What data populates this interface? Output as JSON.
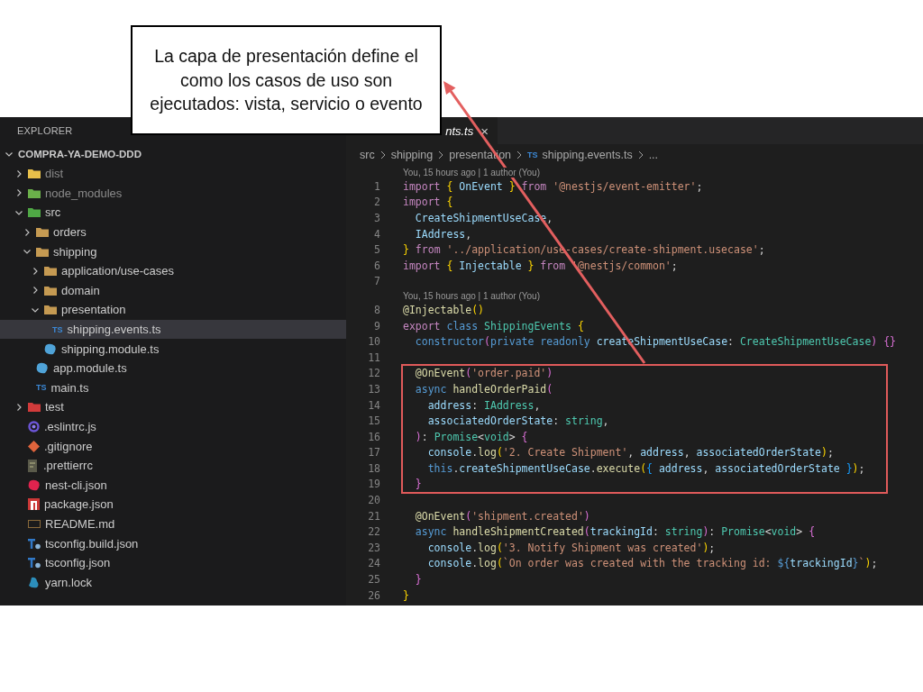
{
  "callout": {
    "text": "La capa de presentación define el como los casos de uso son ejecutados: vista, servicio o evento"
  },
  "explorer": {
    "title": "EXPLORER",
    "project": {
      "label": "COMPRA-YA-DEMO-DDD",
      "expanded": true
    },
    "tree": [
      {
        "label": "dist",
        "kind": "folder",
        "color": "#e8c04a",
        "expanded": false,
        "dimmed": true,
        "selected": false
      },
      {
        "label": "node_modules",
        "kind": "folder",
        "color": "#6bb04a",
        "expanded": false,
        "dimmed": true,
        "selected": false
      },
      {
        "label": "src",
        "kind": "folder",
        "color": "#4fa845",
        "expanded": true,
        "dimmed": false,
        "selected": false,
        "children": [
          {
            "label": "orders",
            "kind": "folder",
            "color": "#c59a52",
            "expanded": false,
            "dimmed": false,
            "selected": false
          },
          {
            "label": "shipping",
            "kind": "folder",
            "color": "#c59a52",
            "expanded": true,
            "dimmed": false,
            "selected": false,
            "children": [
              {
                "label": "application/use-cases",
                "kind": "folder",
                "color": "#c59a52",
                "expanded": false,
                "dimmed": false,
                "selected": false
              },
              {
                "label": "domain",
                "kind": "folder",
                "color": "#c59a52",
                "expanded": false,
                "dimmed": false,
                "selected": false
              },
              {
                "label": "presentation",
                "kind": "folder",
                "color": "#c59a52",
                "expanded": true,
                "dimmed": false,
                "selected": false,
                "children": [
                  {
                    "label": "shipping.events.ts",
                    "kind": "ts",
                    "icon_text": "TS",
                    "dimmed": false,
                    "selected": true
                  }
                ]
              },
              {
                "label": "shipping.module.ts",
                "kind": "module",
                "dimmed": false,
                "selected": false
              }
            ]
          },
          {
            "label": "app.module.ts",
            "kind": "module",
            "dimmed": false,
            "selected": false
          },
          {
            "label": "main.ts",
            "kind": "ts",
            "icon_text": "TS",
            "dimmed": false,
            "selected": false
          }
        ]
      },
      {
        "label": "test",
        "kind": "folder",
        "color": "#d23b3b",
        "expanded": false,
        "dimmed": false,
        "selected": false
      },
      {
        "label": ".eslintrc.js",
        "kind": "eslint",
        "dimmed": false,
        "selected": false
      },
      {
        "label": ".gitignore",
        "kind": "git",
        "dimmed": false,
        "selected": false
      },
      {
        "label": ".prettierrc",
        "kind": "prettier",
        "dimmed": false,
        "selected": false
      },
      {
        "label": "nest-cli.json",
        "kind": "nest",
        "dimmed": false,
        "selected": false
      },
      {
        "label": "package.json",
        "kind": "npm",
        "dimmed": false,
        "selected": false
      },
      {
        "label": "README.md",
        "kind": "markdown",
        "dimmed": false,
        "selected": false
      },
      {
        "label": "tsconfig.build.json",
        "kind": "tsconfig",
        "dimmed": false,
        "selected": false
      },
      {
        "label": "tsconfig.json",
        "kind": "tsconfig",
        "dimmed": false,
        "selected": false
      },
      {
        "label": "yarn.lock",
        "kind": "yarn",
        "dimmed": false,
        "selected": false
      }
    ]
  },
  "tab": {
    "label": "nts.ts",
    "close": "×"
  },
  "breadcrumb": [
    {
      "label": "src"
    },
    {
      "label": "shipping"
    },
    {
      "label": "presentation"
    },
    {
      "label": "shipping.events.ts",
      "icon_text": "TS"
    },
    {
      "label": "..."
    }
  ],
  "code_blocks": [
    {
      "highlighted": false,
      "lines": [
        {
          "kind": "blame",
          "text": "You, 15 hours ago | 1 author (You)"
        },
        {
          "kind": "code",
          "number": "1",
          "tokens": [
            {
              "kind": "keyword",
              "text": "import "
            },
            {
              "kind": "bracket",
              "text": "{ "
            },
            {
              "kind": "variable",
              "text": "OnEvent "
            },
            {
              "kind": "bracket",
              "text": "} "
            },
            {
              "kind": "keyword",
              "text": "from "
            },
            {
              "kind": "string",
              "text": "'@nestjs/event-emitter'"
            },
            {
              "kind": "plain",
              "text": ";"
            }
          ]
        },
        {
          "kind": "code",
          "number": "2",
          "tokens": [
            {
              "kind": "keyword",
              "text": "import "
            },
            {
              "kind": "bracket",
              "text": "{"
            }
          ]
        },
        {
          "kind": "code",
          "number": "3",
          "tokens": [
            {
              "kind": "variable",
              "text": "  CreateShipmentUseCase"
            },
            {
              "kind": "plain",
              "text": ","
            }
          ]
        },
        {
          "kind": "code",
          "number": "4",
          "tokens": [
            {
              "kind": "variable",
              "text": "  IAddress"
            },
            {
              "kind": "plain",
              "text": ","
            }
          ]
        },
        {
          "kind": "code",
          "number": "5",
          "tokens": [
            {
              "kind": "bracket",
              "text": "} "
            },
            {
              "kind": "keyword",
              "text": "from "
            },
            {
              "kind": "string",
              "text": "'../application/use-cases/create-shipment.usecase'"
            },
            {
              "kind": "plain",
              "text": ";"
            }
          ]
        },
        {
          "kind": "code",
          "number": "6",
          "tokens": [
            {
              "kind": "keyword",
              "text": "import "
            },
            {
              "kind": "bracket",
              "text": "{ "
            },
            {
              "kind": "variable",
              "text": "Injectable "
            },
            {
              "kind": "bracket",
              "text": "} "
            },
            {
              "kind": "keyword",
              "text": "from "
            },
            {
              "kind": "string",
              "text": "'@nestjs/common'"
            },
            {
              "kind": "plain",
              "text": ";"
            }
          ]
        },
        {
          "kind": "code",
          "number": "7"
        },
        {
          "kind": "blame",
          "text": "You, 15 hours ago | 1 author (You)"
        },
        {
          "kind": "code",
          "number": "8",
          "tokens": [
            {
              "kind": "function",
              "text": "@Injectable"
            },
            {
              "kind": "bracket",
              "text": "()"
            }
          ]
        },
        {
          "kind": "code",
          "number": "9",
          "tokens": [
            {
              "kind": "keyword",
              "text": "export "
            },
            {
              "kind": "storage",
              "text": "class "
            },
            {
              "kind": "type",
              "text": "ShippingEvents "
            },
            {
              "kind": "bracket",
              "text": "{"
            }
          ]
        },
        {
          "kind": "code",
          "number": "10",
          "tokens": [
            {
              "kind": "storage",
              "text": "  constructor"
            },
            {
              "kind": "bracket2",
              "text": "("
            },
            {
              "kind": "storage",
              "text": "private readonly "
            },
            {
              "kind": "variable",
              "text": "createShipmentUseCase"
            },
            {
              "kind": "plain",
              "text": ": "
            },
            {
              "kind": "type",
              "text": "CreateShipmentUseCase"
            },
            {
              "kind": "bracket2",
              "text": ") {}"
            }
          ]
        },
        {
          "kind": "code",
          "number": "11"
        }
      ]
    },
    {
      "highlighted": true,
      "lines": [
        {
          "kind": "code",
          "number": "12",
          "tokens": [
            {
              "kind": "function",
              "text": "  @OnEvent"
            },
            {
              "kind": "bracket2",
              "text": "("
            },
            {
              "kind": "string",
              "text": "'order.paid'"
            },
            {
              "kind": "bracket2",
              "text": ")"
            }
          ]
        },
        {
          "kind": "code",
          "number": "13",
          "tokens": [
            {
              "kind": "storage",
              "text": "  async "
            },
            {
              "kind": "function",
              "text": "handleOrderPaid"
            },
            {
              "kind": "bracket2",
              "text": "("
            }
          ]
        },
        {
          "kind": "code",
          "number": "14",
          "tokens": [
            {
              "kind": "variable",
              "text": "    address"
            },
            {
              "kind": "plain",
              "text": ": "
            },
            {
              "kind": "type",
              "text": "IAddress"
            },
            {
              "kind": "plain",
              "text": ","
            }
          ]
        },
        {
          "kind": "code",
          "number": "15",
          "tokens": [
            {
              "kind": "variable",
              "text": "    associatedOrderState"
            },
            {
              "kind": "plain",
              "text": ": "
            },
            {
              "kind": "type",
              "text": "string"
            },
            {
              "kind": "plain",
              "text": ","
            }
          ]
        },
        {
          "kind": "code",
          "number": "16",
          "tokens": [
            {
              "kind": "bracket2",
              "text": "  )"
            },
            {
              "kind": "plain",
              "text": ": "
            },
            {
              "kind": "type",
              "text": "Promise"
            },
            {
              "kind": "plain",
              "text": "<"
            },
            {
              "kind": "type",
              "text": "void"
            },
            {
              "kind": "plain",
              "text": "> "
            },
            {
              "kind": "bracket2",
              "text": "{"
            }
          ]
        },
        {
          "kind": "code",
          "number": "17",
          "tokens": [
            {
              "kind": "variable",
              "text": "    console"
            },
            {
              "kind": "plain",
              "text": "."
            },
            {
              "kind": "function",
              "text": "log"
            },
            {
              "kind": "bracket",
              "text": "("
            },
            {
              "kind": "string",
              "text": "'2. Create Shipment'"
            },
            {
              "kind": "plain",
              "text": ", "
            },
            {
              "kind": "variable",
              "text": "address"
            },
            {
              "kind": "plain",
              "text": ", "
            },
            {
              "kind": "variable",
              "text": "associatedOrderState"
            },
            {
              "kind": "bracket",
              "text": ")"
            },
            {
              "kind": "plain",
              "text": ";"
            }
          ]
        },
        {
          "kind": "code",
          "number": "18",
          "tokens": [
            {
              "kind": "storage",
              "text": "    this"
            },
            {
              "kind": "plain",
              "text": "."
            },
            {
              "kind": "variable",
              "text": "createShipmentUseCase"
            },
            {
              "kind": "plain",
              "text": "."
            },
            {
              "kind": "function",
              "text": "execute"
            },
            {
              "kind": "bracket",
              "text": "("
            },
            {
              "kind": "bracket3",
              "text": "{ "
            },
            {
              "kind": "variable",
              "text": "address"
            },
            {
              "kind": "plain",
              "text": ", "
            },
            {
              "kind": "variable",
              "text": "associatedOrderState "
            },
            {
              "kind": "bracket3",
              "text": "}"
            },
            {
              "kind": "bracket",
              "text": ")"
            },
            {
              "kind": "plain",
              "text": ";"
            }
          ]
        },
        {
          "kind": "code",
          "number": "19",
          "tokens": [
            {
              "kind": "bracket2",
              "text": "  }"
            }
          ]
        }
      ]
    },
    {
      "highlighted": false,
      "lines": [
        {
          "kind": "code",
          "number": "20"
        },
        {
          "kind": "code",
          "number": "21",
          "tokens": [
            {
              "kind": "function",
              "text": "  @OnEvent"
            },
            {
              "kind": "bracket2",
              "text": "("
            },
            {
              "kind": "string",
              "text": "'shipment.created'"
            },
            {
              "kind": "bracket2",
              "text": ")"
            }
          ]
        },
        {
          "kind": "code",
          "number": "22",
          "tokens": [
            {
              "kind": "storage",
              "text": "  async "
            },
            {
              "kind": "function",
              "text": "handleShipmentCreated"
            },
            {
              "kind": "bracket2",
              "text": "("
            },
            {
              "kind": "variable",
              "text": "trackingId"
            },
            {
              "kind": "plain",
              "text": ": "
            },
            {
              "kind": "type",
              "text": "string"
            },
            {
              "kind": "bracket2",
              "text": ")"
            },
            {
              "kind": "plain",
              "text": ": "
            },
            {
              "kind": "type",
              "text": "Promise"
            },
            {
              "kind": "plain",
              "text": "<"
            },
            {
              "kind": "type",
              "text": "void"
            },
            {
              "kind": "plain",
              "text": "> "
            },
            {
              "kind": "bracket2",
              "text": "{"
            }
          ]
        },
        {
          "kind": "code",
          "number": "23",
          "tokens": [
            {
              "kind": "variable",
              "text": "    console"
            },
            {
              "kind": "plain",
              "text": "."
            },
            {
              "kind": "function",
              "text": "log"
            },
            {
              "kind": "bracket",
              "text": "("
            },
            {
              "kind": "string",
              "text": "'3. Notify Shipment was created'"
            },
            {
              "kind": "bracket",
              "text": ")"
            },
            {
              "kind": "plain",
              "text": ";"
            }
          ]
        },
        {
          "kind": "code",
          "number": "24",
          "tokens": [
            {
              "kind": "variable",
              "text": "    console"
            },
            {
              "kind": "plain",
              "text": "."
            },
            {
              "kind": "function",
              "text": "log"
            },
            {
              "kind": "bracket",
              "text": "("
            },
            {
              "kind": "string",
              "text": "`On order was created with the tracking id: "
            },
            {
              "kind": "storage",
              "text": "${"
            },
            {
              "kind": "variable",
              "text": "trackingId"
            },
            {
              "kind": "storage",
              "text": "}"
            },
            {
              "kind": "string",
              "text": "`"
            },
            {
              "kind": "bracket",
              "text": ")"
            },
            {
              "kind": "plain",
              "text": ";"
            }
          ]
        },
        {
          "kind": "code",
          "number": "25",
          "tokens": [
            {
              "kind": "bracket2",
              "text": "  }"
            }
          ]
        },
        {
          "kind": "code",
          "number": "26",
          "tokens": [
            {
              "kind": "bracket",
              "text": "}"
            }
          ]
        }
      ]
    }
  ]
}
